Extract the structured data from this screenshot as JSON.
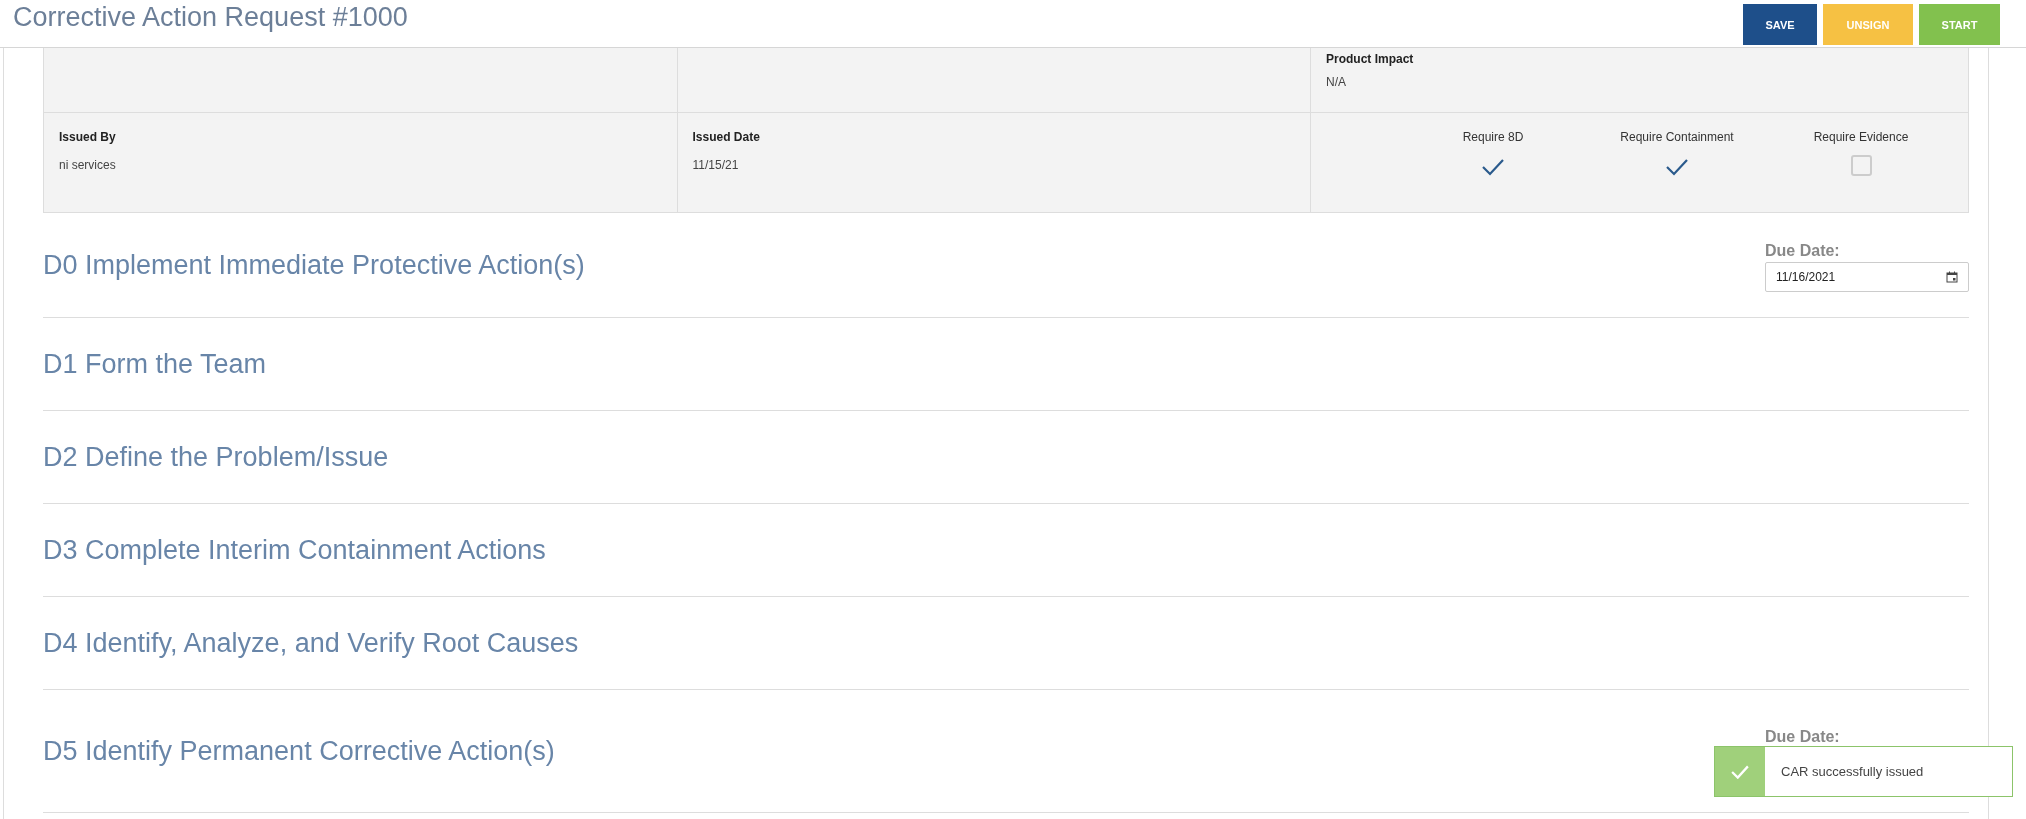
{
  "header": {
    "title": "Corrective Action Request #1000",
    "buttons": [
      {
        "label": "SAVE",
        "kind": "primary"
      },
      {
        "label": "UNSIGN",
        "kind": "warning"
      },
      {
        "label": "START",
        "kind": "success"
      }
    ]
  },
  "summary": {
    "product_impact": {
      "label": "Product Impact",
      "value": "N/A"
    },
    "issued_by": {
      "label": "Issued By",
      "value": "ni services"
    },
    "issued_date": {
      "label": "Issued Date",
      "value": "11/15/21"
    },
    "requirements": [
      {
        "label": "Require 8D",
        "checked": true
      },
      {
        "label": "Require Containment",
        "checked": true
      },
      {
        "label": "Require Evidence",
        "checked": false
      }
    ]
  },
  "sections": [
    {
      "title": "D0 Implement Immediate Protective Action(s)",
      "due_label": "Due Date:",
      "due_value": "11/16/2021"
    },
    {
      "title": "D1 Form the Team"
    },
    {
      "title": "D2 Define the Problem/Issue"
    },
    {
      "title": "D3 Complete Interim Containment Actions"
    },
    {
      "title": "D4 Identify, Analyze, and Verify Root Causes"
    },
    {
      "title": "D5 Identify Permanent Corrective Action(s)",
      "due_label": "Due Date:"
    }
  ],
  "toast": {
    "message": "CAR successfully issued"
  }
}
